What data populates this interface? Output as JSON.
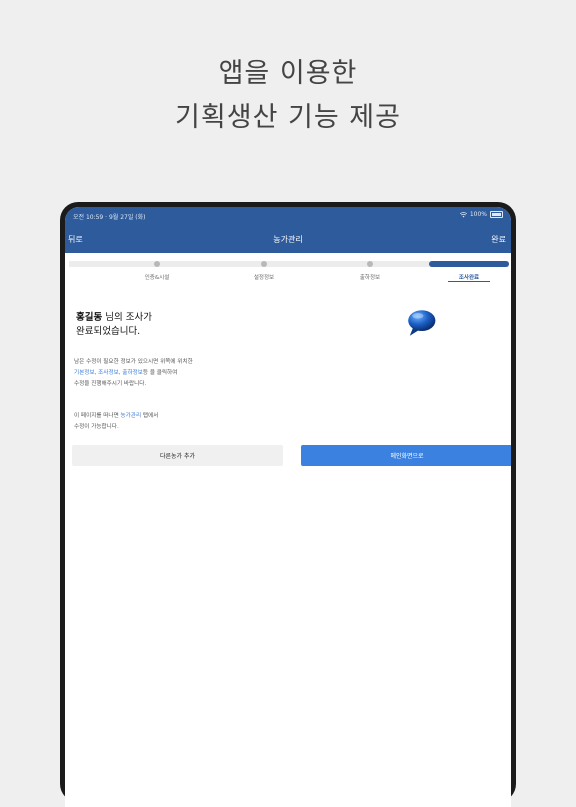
{
  "promo": {
    "line1": "앱을 이용한",
    "line2": "기획생산 기능 제공"
  },
  "statusbar": {
    "time": "오전 10:59 · 9월 27일 (화)",
    "battery": "100%"
  },
  "navbar": {
    "back": "뒤로",
    "title": "농가관리",
    "done": "완료"
  },
  "steps": [
    {
      "label": "인증&시설"
    },
    {
      "label": "설정정보"
    },
    {
      "label": "출하정보"
    },
    {
      "label": "조사완료"
    }
  ],
  "complete": {
    "name": "홍길동",
    "suffix1": " 님의 조사가",
    "line2": "완료되었습니다."
  },
  "desc": {
    "line1": "남은 수정이 필요한 정보가 있으시면 위쪽에 위치한",
    "link1": "기본정보",
    "sep1": ", ",
    "link2": "조사정보",
    "sep2": ", ",
    "link3": "출하정보",
    "line2_tail": "등 을 클릭하여",
    "line3": "수정을 진행해주시기 바랍니다."
  },
  "desc2": {
    "prefix": "이 페이지를 떠나면 ",
    "link": "농가관리",
    "suffix": " 탭에서",
    "line2": "수정이 가능합니다."
  },
  "buttons": {
    "add_other": "다른농가 추가",
    "main": "메인화면으로"
  },
  "colors": {
    "navbar": "#2d5b9c",
    "primary_button": "#3b82e0",
    "link": "#3a7bd5"
  }
}
